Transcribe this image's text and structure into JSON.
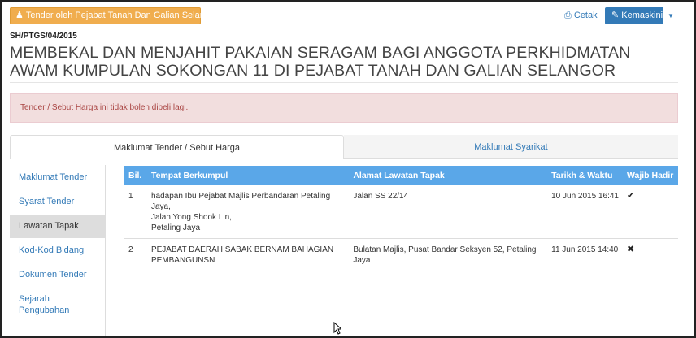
{
  "header": {
    "back_button_label": "Tender oleh Pejabat Tanah Dan Galian Selangor",
    "print_label": "Cetak",
    "edit_label": "Kemaskini"
  },
  "tender": {
    "reference": "SH/PTGS/04/2015",
    "title": "MEMBEKAL DAN MENJAHIT PAKAIAN SERAGAM BAGI ANGGOTA PERKHIDMATAN AWAM KUMPULAN SOKONGAN 11 DI PEJABAT TANAH DAN GALIAN SELANGOR"
  },
  "alert": {
    "message": "Tender / Sebut Harga ini tidak boleh dibeli lagi."
  },
  "tabs": [
    {
      "label": "Maklumat Tender / Sebut Harga",
      "active": true
    },
    {
      "label": "Maklumat Syarikat",
      "active": false
    }
  ],
  "sidebar": {
    "items": [
      {
        "label": "Maklumat Tender",
        "active": false
      },
      {
        "label": "Syarat Tender",
        "active": false
      },
      {
        "label": "Lawatan Tapak",
        "active": true
      },
      {
        "label": "Kod-Kod Bidang",
        "active": false
      },
      {
        "label": "Dokumen Tender",
        "active": false
      },
      {
        "label": "Sejarah Pengubahan",
        "active": false
      }
    ]
  },
  "table": {
    "columns": [
      "Bil.",
      "Tempat Berkumpul",
      "Alamat Lawatan Tapak",
      "Tarikh & Waktu",
      "Wajib Hadir"
    ],
    "rows": [
      {
        "no": "1",
        "place": [
          "hadapan Ibu Pejabat Majlis Perbandaran Petaling Jaya,",
          "Jalan Yong Shook Lin,",
          "Petaling Jaya"
        ],
        "address": "Jalan SS 22/14",
        "datetime": "10 Jun 2015 16:41",
        "mandatory_icon": "check-icon"
      },
      {
        "no": "2",
        "place": [
          "PEJABAT DAERAH SABAK BERNAM BAHAGIAN",
          "PEMBANGUNSN"
        ],
        "address": "Bulatan Majlis, Pusat Bandar Seksyen 52, Petaling Jaya",
        "datetime": "11 Jun 2015 14:40",
        "mandatory_icon": "times-icon"
      }
    ]
  },
  "colors": {
    "warning_button": "#f0ad4e",
    "primary_button": "#337ab7",
    "table_header": "#5aa7e8",
    "alert_bg": "#f2dede",
    "alert_text": "#a94442"
  }
}
